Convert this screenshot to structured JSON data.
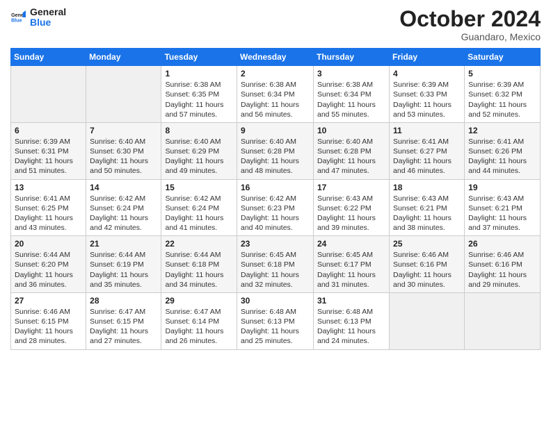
{
  "header": {
    "logo_line1": "General",
    "logo_line2": "Blue",
    "month_title": "October 2024",
    "subtitle": "Guandaro, Mexico"
  },
  "weekdays": [
    "Sunday",
    "Monday",
    "Tuesday",
    "Wednesday",
    "Thursday",
    "Friday",
    "Saturday"
  ],
  "weeks": [
    [
      {
        "day": "",
        "sunrise": "",
        "sunset": "",
        "daylight": ""
      },
      {
        "day": "",
        "sunrise": "",
        "sunset": "",
        "daylight": ""
      },
      {
        "day": "1",
        "sunrise": "Sunrise: 6:38 AM",
        "sunset": "Sunset: 6:35 PM",
        "daylight": "Daylight: 11 hours and 57 minutes."
      },
      {
        "day": "2",
        "sunrise": "Sunrise: 6:38 AM",
        "sunset": "Sunset: 6:34 PM",
        "daylight": "Daylight: 11 hours and 56 minutes."
      },
      {
        "day": "3",
        "sunrise": "Sunrise: 6:38 AM",
        "sunset": "Sunset: 6:34 PM",
        "daylight": "Daylight: 11 hours and 55 minutes."
      },
      {
        "day": "4",
        "sunrise": "Sunrise: 6:39 AM",
        "sunset": "Sunset: 6:33 PM",
        "daylight": "Daylight: 11 hours and 53 minutes."
      },
      {
        "day": "5",
        "sunrise": "Sunrise: 6:39 AM",
        "sunset": "Sunset: 6:32 PM",
        "daylight": "Daylight: 11 hours and 52 minutes."
      }
    ],
    [
      {
        "day": "6",
        "sunrise": "Sunrise: 6:39 AM",
        "sunset": "Sunset: 6:31 PM",
        "daylight": "Daylight: 11 hours and 51 minutes."
      },
      {
        "day": "7",
        "sunrise": "Sunrise: 6:40 AM",
        "sunset": "Sunset: 6:30 PM",
        "daylight": "Daylight: 11 hours and 50 minutes."
      },
      {
        "day": "8",
        "sunrise": "Sunrise: 6:40 AM",
        "sunset": "Sunset: 6:29 PM",
        "daylight": "Daylight: 11 hours and 49 minutes."
      },
      {
        "day": "9",
        "sunrise": "Sunrise: 6:40 AM",
        "sunset": "Sunset: 6:28 PM",
        "daylight": "Daylight: 11 hours and 48 minutes."
      },
      {
        "day": "10",
        "sunrise": "Sunrise: 6:40 AM",
        "sunset": "Sunset: 6:28 PM",
        "daylight": "Daylight: 11 hours and 47 minutes."
      },
      {
        "day": "11",
        "sunrise": "Sunrise: 6:41 AM",
        "sunset": "Sunset: 6:27 PM",
        "daylight": "Daylight: 11 hours and 46 minutes."
      },
      {
        "day": "12",
        "sunrise": "Sunrise: 6:41 AM",
        "sunset": "Sunset: 6:26 PM",
        "daylight": "Daylight: 11 hours and 44 minutes."
      }
    ],
    [
      {
        "day": "13",
        "sunrise": "Sunrise: 6:41 AM",
        "sunset": "Sunset: 6:25 PM",
        "daylight": "Daylight: 11 hours and 43 minutes."
      },
      {
        "day": "14",
        "sunrise": "Sunrise: 6:42 AM",
        "sunset": "Sunset: 6:24 PM",
        "daylight": "Daylight: 11 hours and 42 minutes."
      },
      {
        "day": "15",
        "sunrise": "Sunrise: 6:42 AM",
        "sunset": "Sunset: 6:24 PM",
        "daylight": "Daylight: 11 hours and 41 minutes."
      },
      {
        "day": "16",
        "sunrise": "Sunrise: 6:42 AM",
        "sunset": "Sunset: 6:23 PM",
        "daylight": "Daylight: 11 hours and 40 minutes."
      },
      {
        "day": "17",
        "sunrise": "Sunrise: 6:43 AM",
        "sunset": "Sunset: 6:22 PM",
        "daylight": "Daylight: 11 hours and 39 minutes."
      },
      {
        "day": "18",
        "sunrise": "Sunrise: 6:43 AM",
        "sunset": "Sunset: 6:21 PM",
        "daylight": "Daylight: 11 hours and 38 minutes."
      },
      {
        "day": "19",
        "sunrise": "Sunrise: 6:43 AM",
        "sunset": "Sunset: 6:21 PM",
        "daylight": "Daylight: 11 hours and 37 minutes."
      }
    ],
    [
      {
        "day": "20",
        "sunrise": "Sunrise: 6:44 AM",
        "sunset": "Sunset: 6:20 PM",
        "daylight": "Daylight: 11 hours and 36 minutes."
      },
      {
        "day": "21",
        "sunrise": "Sunrise: 6:44 AM",
        "sunset": "Sunset: 6:19 PM",
        "daylight": "Daylight: 11 hours and 35 minutes."
      },
      {
        "day": "22",
        "sunrise": "Sunrise: 6:44 AM",
        "sunset": "Sunset: 6:18 PM",
        "daylight": "Daylight: 11 hours and 34 minutes."
      },
      {
        "day": "23",
        "sunrise": "Sunrise: 6:45 AM",
        "sunset": "Sunset: 6:18 PM",
        "daylight": "Daylight: 11 hours and 32 minutes."
      },
      {
        "day": "24",
        "sunrise": "Sunrise: 6:45 AM",
        "sunset": "Sunset: 6:17 PM",
        "daylight": "Daylight: 11 hours and 31 minutes."
      },
      {
        "day": "25",
        "sunrise": "Sunrise: 6:46 AM",
        "sunset": "Sunset: 6:16 PM",
        "daylight": "Daylight: 11 hours and 30 minutes."
      },
      {
        "day": "26",
        "sunrise": "Sunrise: 6:46 AM",
        "sunset": "Sunset: 6:16 PM",
        "daylight": "Daylight: 11 hours and 29 minutes."
      }
    ],
    [
      {
        "day": "27",
        "sunrise": "Sunrise: 6:46 AM",
        "sunset": "Sunset: 6:15 PM",
        "daylight": "Daylight: 11 hours and 28 minutes."
      },
      {
        "day": "28",
        "sunrise": "Sunrise: 6:47 AM",
        "sunset": "Sunset: 6:15 PM",
        "daylight": "Daylight: 11 hours and 27 minutes."
      },
      {
        "day": "29",
        "sunrise": "Sunrise: 6:47 AM",
        "sunset": "Sunset: 6:14 PM",
        "daylight": "Daylight: 11 hours and 26 minutes."
      },
      {
        "day": "30",
        "sunrise": "Sunrise: 6:48 AM",
        "sunset": "Sunset: 6:13 PM",
        "daylight": "Daylight: 11 hours and 25 minutes."
      },
      {
        "day": "31",
        "sunrise": "Sunrise: 6:48 AM",
        "sunset": "Sunset: 6:13 PM",
        "daylight": "Daylight: 11 hours and 24 minutes."
      },
      {
        "day": "",
        "sunrise": "",
        "sunset": "",
        "daylight": ""
      },
      {
        "day": "",
        "sunrise": "",
        "sunset": "",
        "daylight": ""
      }
    ]
  ]
}
